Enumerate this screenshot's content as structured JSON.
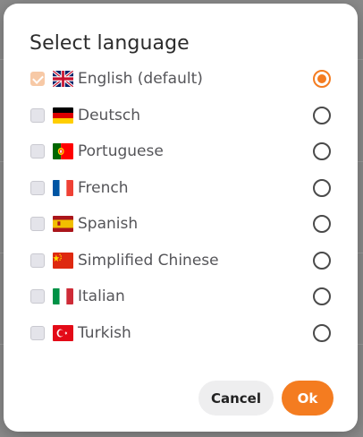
{
  "dialog": {
    "title": "Select language",
    "languages": [
      {
        "label": "English (default)",
        "flag": "uk-flag-icon",
        "checked": true,
        "selected": true
      },
      {
        "label": "Deutsch",
        "flag": "germany-flag-icon",
        "checked": false,
        "selected": false
      },
      {
        "label": "Portuguese",
        "flag": "portugal-flag-icon",
        "checked": false,
        "selected": false
      },
      {
        "label": "French",
        "flag": "france-flag-icon",
        "checked": false,
        "selected": false
      },
      {
        "label": "Spanish",
        "flag": "spain-flag-icon",
        "checked": false,
        "selected": false
      },
      {
        "label": "Simplified Chinese",
        "flag": "china-flag-icon",
        "checked": false,
        "selected": false
      },
      {
        "label": "Italian",
        "flag": "italy-flag-icon",
        "checked": false,
        "selected": false
      },
      {
        "label": "Turkish",
        "flag": "turkey-flag-icon",
        "checked": false,
        "selected": false
      }
    ],
    "cancel_label": "Cancel",
    "ok_label": "Ok"
  },
  "colors": {
    "accent": "#f47c20",
    "checkbox_checked": "#f7c9a6",
    "cancel_bg": "#eeeeef",
    "backdrop": "#8a8a8a"
  }
}
